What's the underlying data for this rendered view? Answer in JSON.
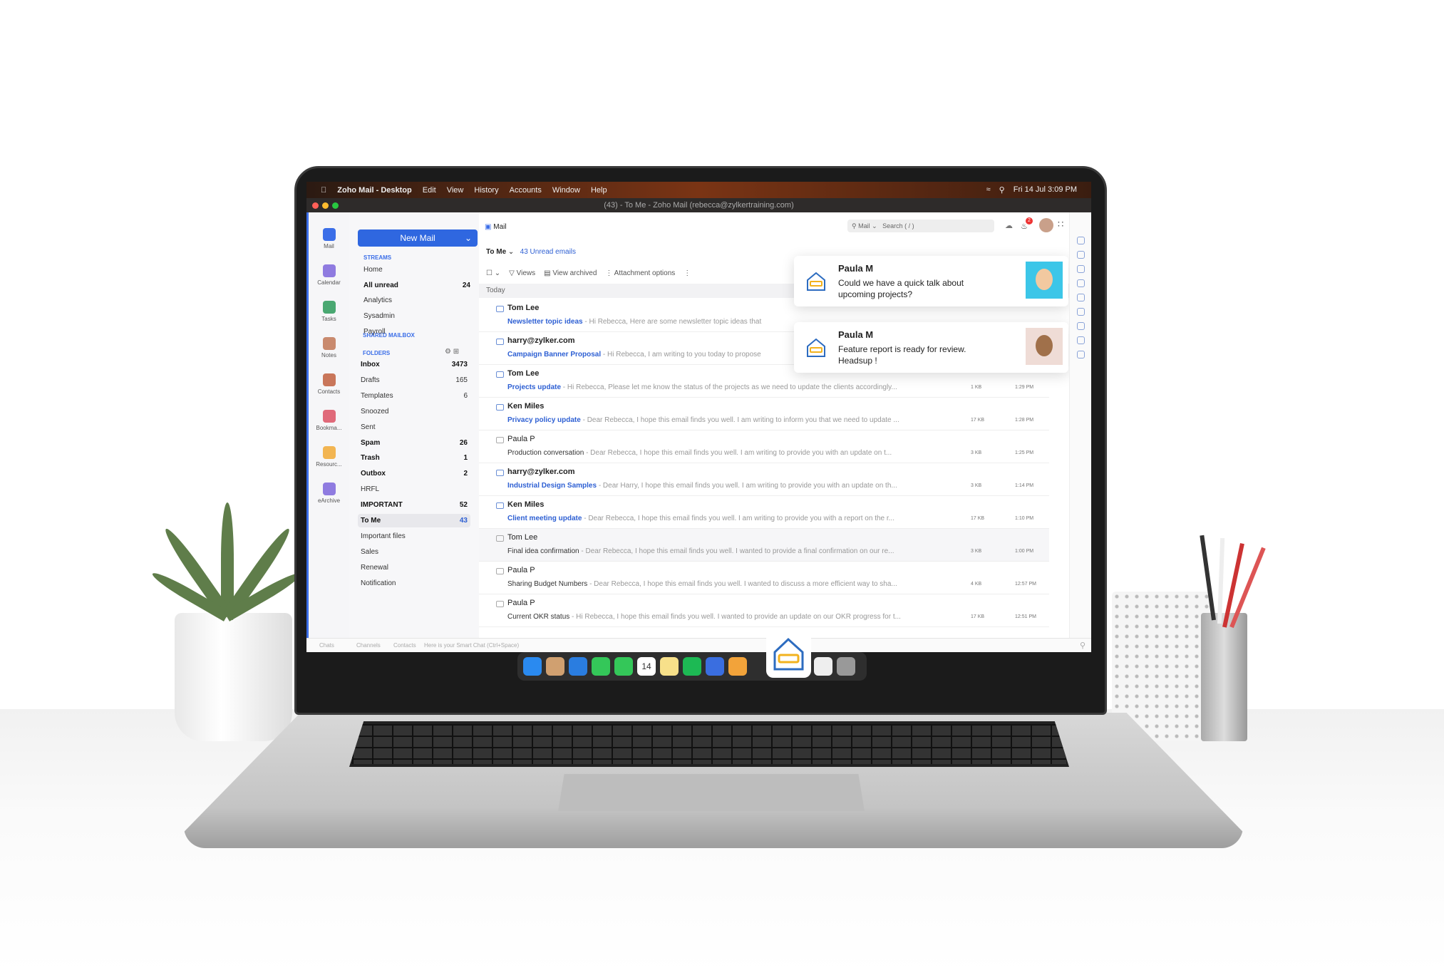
{
  "menubar": {
    "app": "Zoho Mail - Desktop",
    "items": [
      "Edit",
      "View",
      "History",
      "Accounts",
      "Window",
      "Help"
    ],
    "clock": "Fri 14 Jul  3:09 PM"
  },
  "window_title": "(43) - To Me - Zoho Mail (rebecca@zylkertraining.com)",
  "header": {
    "search_scope": "Mail",
    "search_placeholder": "Search ( / )",
    "notification_count": "2"
  },
  "rail": [
    {
      "label": "Mail",
      "color": "#3b6ee8"
    },
    {
      "label": "Calendar",
      "color": "#8f7be0"
    },
    {
      "label": "Tasks",
      "color": "#4aa872"
    },
    {
      "label": "Notes",
      "color": "#c98a6e"
    },
    {
      "label": "Contacts",
      "color": "#c9765a"
    },
    {
      "label": "Bookma...",
      "color": "#e06a7a"
    },
    {
      "label": "Resourc...",
      "color": "#f2b552"
    },
    {
      "label": "eArchive",
      "color": "#8f7be0"
    }
  ],
  "folders": {
    "new_mail": "New Mail",
    "streams_label": "STREAMS",
    "streams": [
      {
        "name": "Home",
        "count": "",
        "bold": false
      },
      {
        "name": "All unread",
        "count": "24",
        "bold": true
      },
      {
        "name": "Analytics",
        "count": "",
        "bold": false
      },
      {
        "name": "Sysadmin",
        "count": "",
        "bold": false
      },
      {
        "name": "Payroll",
        "count": "",
        "bold": false
      }
    ],
    "shared_label": "SHARED MAILBOX",
    "folders_label": "FOLDERS",
    "items": [
      {
        "name": "Inbox",
        "count": "3473",
        "bold": true
      },
      {
        "name": "Drafts",
        "count": "165",
        "bold": false
      },
      {
        "name": "Templates",
        "count": "6",
        "bold": false
      },
      {
        "name": "Snoozed",
        "count": "",
        "bold": false
      },
      {
        "name": "Sent",
        "count": "",
        "bold": false
      },
      {
        "name": "Spam",
        "count": "26",
        "bold": true
      },
      {
        "name": "Trash",
        "count": "1",
        "bold": true
      },
      {
        "name": "Outbox",
        "count": "2",
        "bold": true
      },
      {
        "name": "HRFL",
        "count": "",
        "bold": false
      },
      {
        "name": "IMPORTANT",
        "count": "52",
        "bold": true
      },
      {
        "name": "To Me",
        "count": "43",
        "bold": true,
        "selected": true
      },
      {
        "name": "Important files",
        "count": "",
        "bold": false
      },
      {
        "name": "Sales",
        "count": "",
        "bold": false
      },
      {
        "name": "Renewal",
        "count": "",
        "bold": false
      },
      {
        "name": "Notification",
        "count": "",
        "bold": false
      }
    ]
  },
  "main": {
    "tab": "Mail",
    "view": "To Me",
    "unread": "43 Unread emails",
    "toolbar": [
      "Views",
      "View archived",
      "Attachment options"
    ],
    "group": "Today",
    "emails": [
      {
        "from": "Tom Lee",
        "subject": "Newsletter topic ideas",
        "preview": " - Hi Rebecca, Here are some newsletter topic ideas that",
        "size": "",
        "time": "",
        "unread": true
      },
      {
        "from": "harry@zylker.com",
        "subject": "Campaign Banner Proposal",
        "preview": " - Hi Rebecca, I am writing to you today to propose",
        "size": "",
        "time": "",
        "unread": true
      },
      {
        "from": "Tom Lee",
        "subject": "Projects update",
        "preview": " - Hi Rebecca, Please let me know the status of the projects as we need to update the clients accordingly...",
        "size": "1 KB",
        "time": "1:29 PM",
        "unread": true
      },
      {
        "from": "Ken Miles",
        "subject": "Privacy policy update",
        "preview": " - Dear Rebecca, I hope this email finds you well. I am writing to inform you that we need to update ...",
        "size": "17 KB",
        "time": "1:28 PM",
        "unread": true
      },
      {
        "from": "Paula P",
        "subject": "Production conversation",
        "preview": " - Dear Rebecca, I hope this email finds you well. I am writing to provide you with an update on t...",
        "size": "3 KB",
        "time": "1:25 PM",
        "unread": false
      },
      {
        "from": "harry@zylker.com",
        "subject": "Industrial Design Samples",
        "preview": " - Dear Harry, I hope this email finds you well. I am writing to provide you with an update on th...",
        "size": "3 KB",
        "time": "1:14 PM",
        "unread": true
      },
      {
        "from": "Ken Miles",
        "subject": "Client meeting update",
        "preview": " - Dear Rebecca, I hope this email finds you well. I am writing to provide you with a report on the r...",
        "size": "17 KB",
        "time": "1:10 PM",
        "unread": true
      },
      {
        "from": "Tom Lee",
        "subject": "Final idea confirmation",
        "preview": " - Dear Rebecca, I hope this email finds you well. I wanted to provide a final confirmation on our re...",
        "size": "3 KB",
        "time": "1:00 PM",
        "unread": false
      },
      {
        "from": "Paula P",
        "subject": "Sharing Budget Numbers",
        "preview": " - Dear Rebecca, I hope this email finds you well. I wanted to discuss a more efficient way to sha...",
        "size": "4 KB",
        "time": "12:57 PM",
        "unread": false
      },
      {
        "from": "Paula P",
        "subject": "Current OKR status",
        "preview": " - Hi Rebecca, I hope this email finds you well. I wanted to provide an update on our OKR progress for t...",
        "size": "17 KB",
        "time": "12:51 PM",
        "unread": false
      }
    ]
  },
  "notifications": [
    {
      "name": "Paula M",
      "message": "Could we have a quick talk about upcoming projects?"
    },
    {
      "name": "Paula M",
      "message": "Feature report is ready for review. Headsup !"
    }
  ],
  "chatbar": {
    "tabs": [
      "Chats",
      "Channels",
      "Contacts"
    ],
    "placeholder": "Here is your Smart Chat (Ctrl+Space)"
  },
  "dock": {
    "calendar_day": "14",
    "colors": [
      "#2a8af0",
      "#d0a070",
      "#2a7de0",
      "#34c759",
      "#34c759",
      "#fff",
      "#f7e08a",
      "#1db954",
      "#3a6ee0",
      "#f2a33a",
      "#e04a3a",
      "#eee",
      "#999"
    ]
  }
}
